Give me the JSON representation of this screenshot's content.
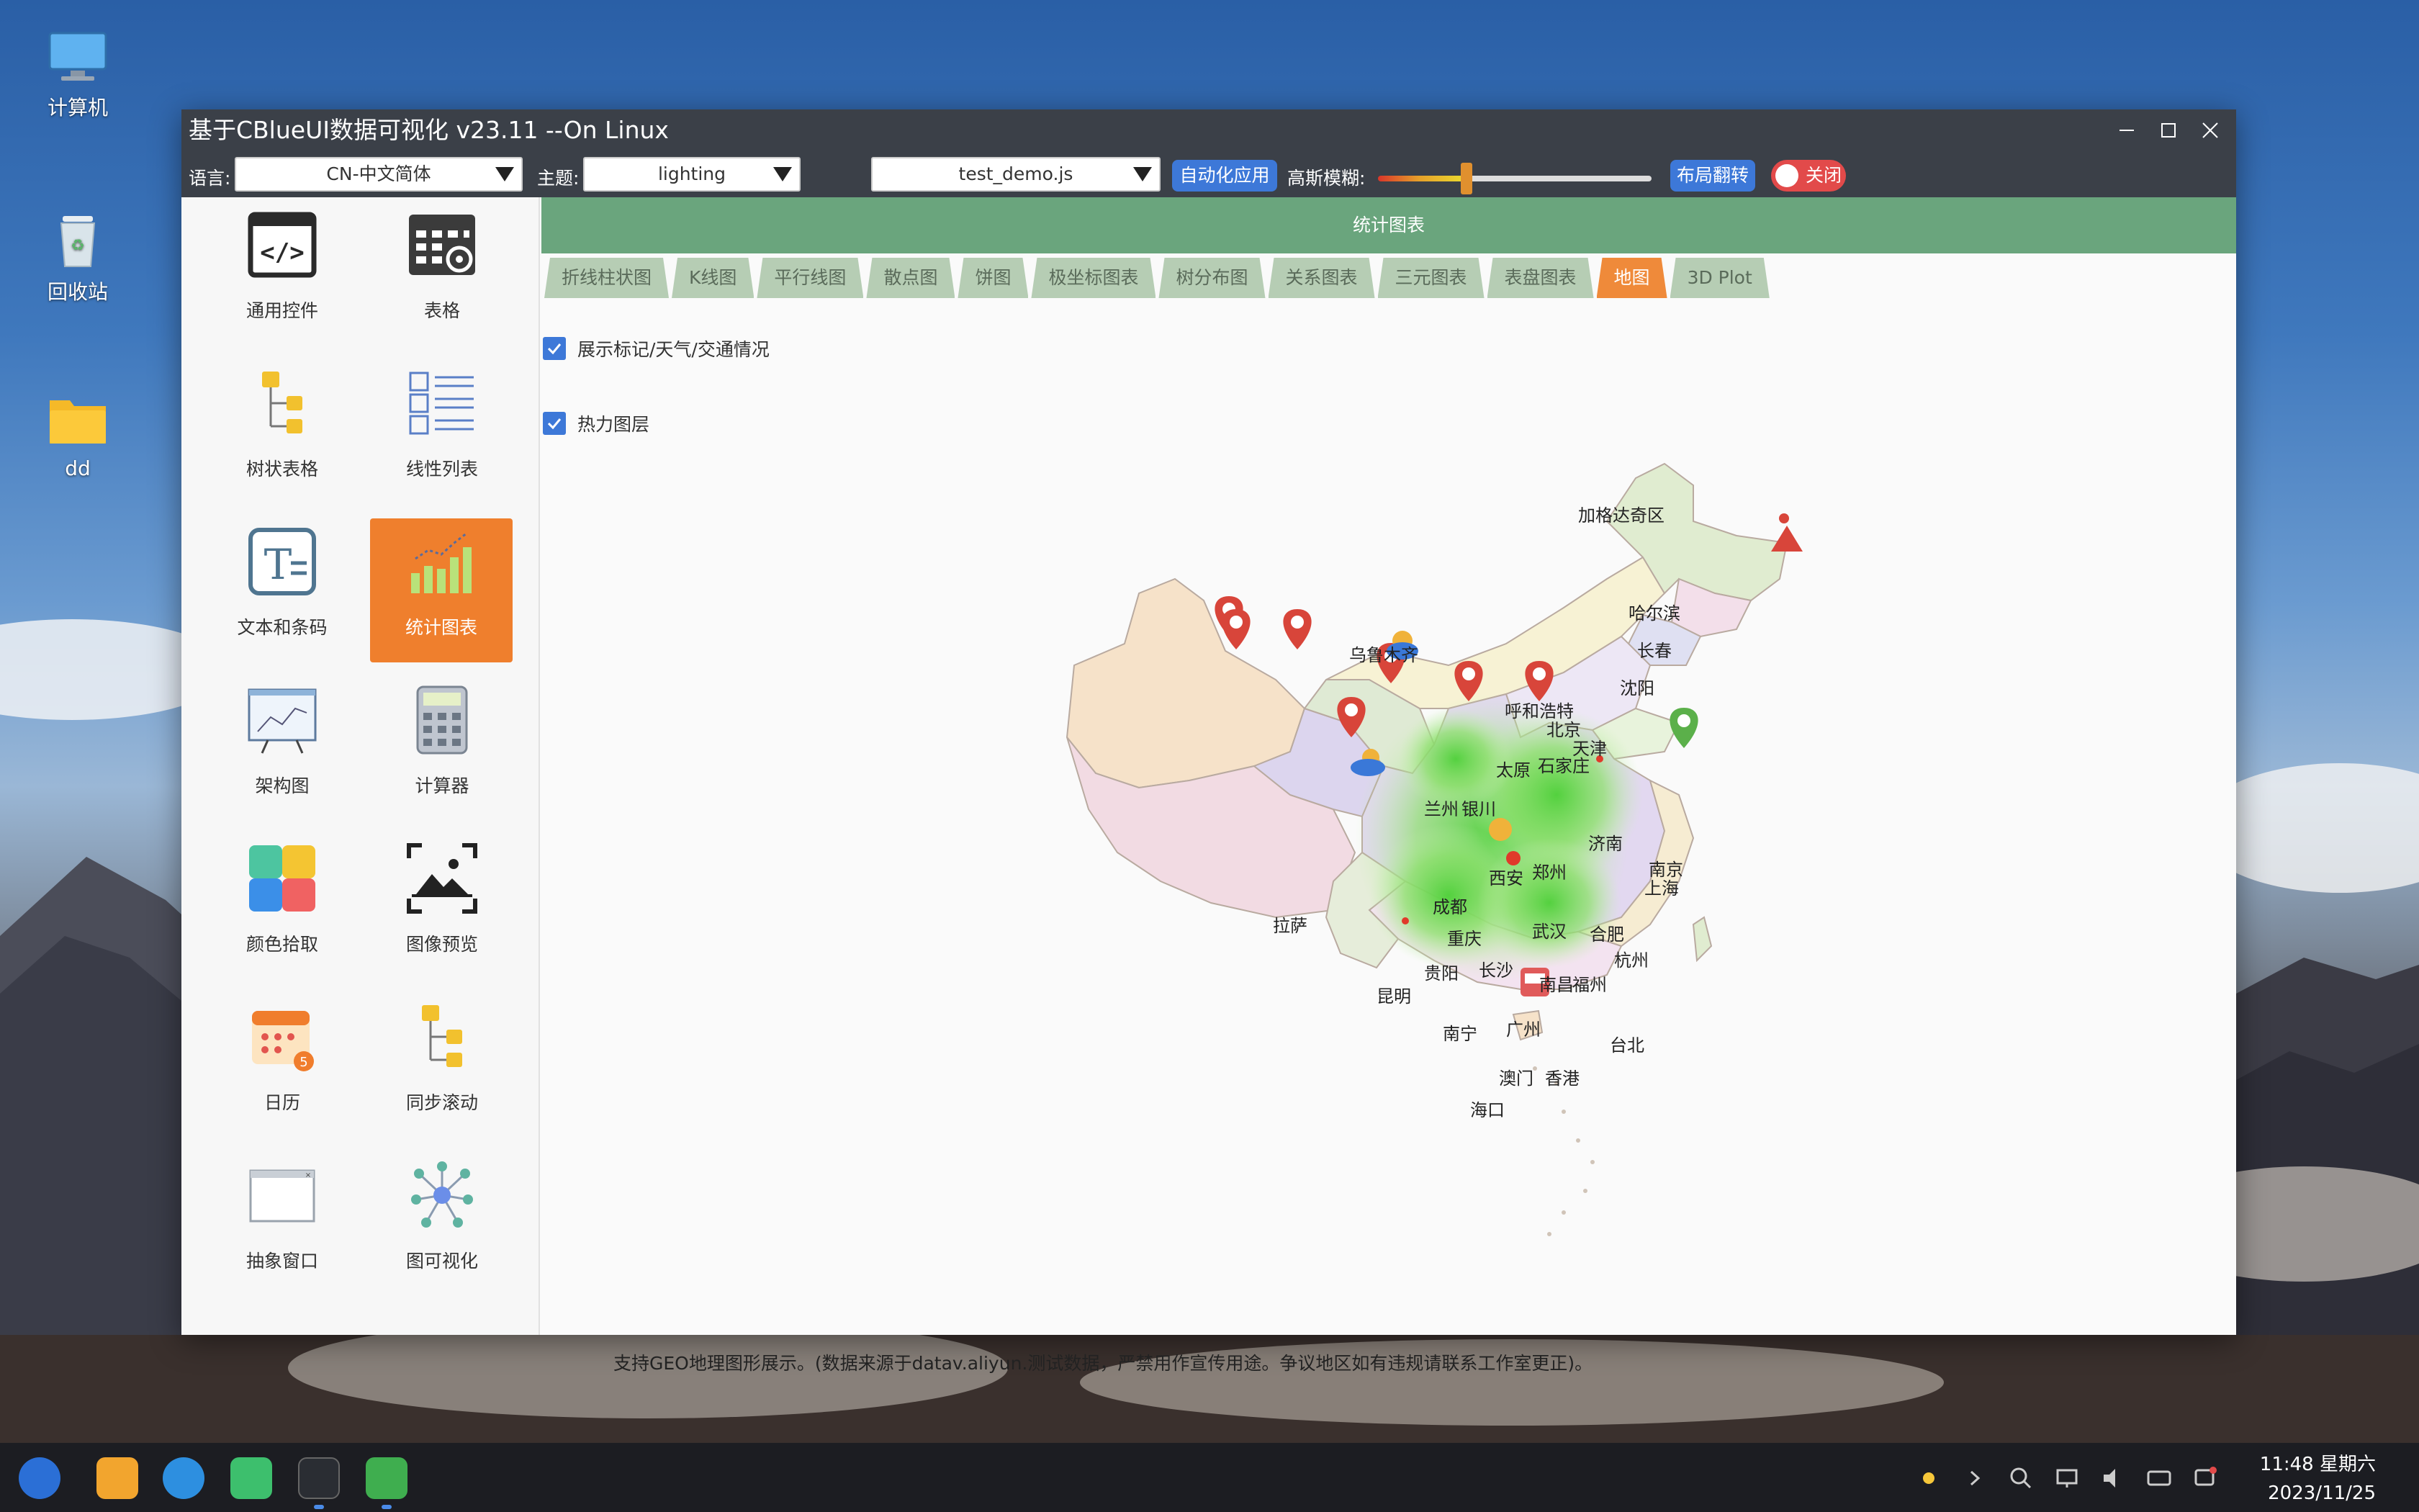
{
  "desktop": {
    "icons": [
      {
        "label": "计算机",
        "icon": "computer-icon"
      },
      {
        "label": "回收站",
        "icon": "trash-icon"
      },
      {
        "label": "dd",
        "icon": "folder-icon"
      }
    ]
  },
  "window": {
    "title": "基于CBlueUI数据可视化 v23.11 --On Linux",
    "toolbar": {
      "language_label": "语言:",
      "language_value": "CN-中文简体",
      "theme_label": "主题:",
      "theme_value": "lighting",
      "script_value": "test_demo.js",
      "auto_apply_label": "自动化应用",
      "blur_label": "高斯模糊:",
      "blur_level": 0.3,
      "flip_layout_label": "布局翻转",
      "toggle_label": "关闭"
    }
  },
  "sidebar": {
    "items": [
      {
        "label": "通用控件",
        "icon": "code-window-icon"
      },
      {
        "label": "表格",
        "icon": "table-settings-icon"
      },
      {
        "label": "树状表格",
        "icon": "tree-table-icon"
      },
      {
        "label": "线性列表",
        "icon": "linear-list-icon"
      },
      {
        "label": "文本和条码",
        "icon": "text-icon"
      },
      {
        "label": "统计图表",
        "icon": "bar-chart-icon",
        "active": true
      },
      {
        "label": "架构图",
        "icon": "architecture-icon"
      },
      {
        "label": "计算器",
        "icon": "calculator-icon"
      },
      {
        "label": "颜色拾取",
        "icon": "color-picker-icon"
      },
      {
        "label": "图像预览",
        "icon": "image-preview-icon"
      },
      {
        "label": "日历",
        "icon": "calendar-icon"
      },
      {
        "label": "同步滚动",
        "icon": "sync-scroll-icon"
      },
      {
        "label": "抽象窗口",
        "icon": "abstract-window-icon"
      },
      {
        "label": "图可视化",
        "icon": "graph-icon"
      }
    ]
  },
  "content": {
    "header": "统计图表",
    "tabs": [
      "折线柱状图",
      "K线图",
      "平行线图",
      "散点图",
      "饼图",
      "极坐标图表",
      "树分布图",
      "关系图表",
      "三元图表",
      "表盘图表",
      "地图",
      "3D Plot"
    ],
    "active_tab": "地图",
    "options": [
      {
        "label": "展示标记/天气/交通情况",
        "checked": true
      },
      {
        "label": "热力图层",
        "checked": true
      }
    ],
    "map_cities": [
      "加格达奇区",
      "哈尔滨",
      "长春",
      "沈阳",
      "乌鲁木齐",
      "呼和浩特",
      "北京",
      "天津",
      "石家庄",
      "太原",
      "兰州",
      "银川",
      "济南",
      "西安",
      "郑州",
      "南京",
      "上海",
      "成都",
      "拉萨",
      "重庆",
      "武汉",
      "合肥",
      "杭州",
      "贵阳",
      "长沙",
      "南昌",
      "福州",
      "昆明",
      "南宁",
      "广州",
      "台北",
      "澳门",
      "香港",
      "海口"
    ],
    "footer": "支持GEO地理图形展示。(数据来源于datav.aliyun.测试数据，严禁用作宣传用途。争议地区如有违规请联系工作室更正)。"
  },
  "taskbar": {
    "apps": [
      "launcher-icon",
      "files-icon",
      "browser-icon",
      "mail-icon",
      "terminal-icon",
      "app-a-icon"
    ],
    "tray": [
      "brightness-icon",
      "expand-arrow-icon",
      "search-icon",
      "network-icon",
      "volume-icon",
      "keyboard-icon",
      "notification-icon"
    ],
    "time": "11:48 星期六",
    "date": "2023/11/25"
  },
  "colors": {
    "titlebar": "#3b4048",
    "accent_orange": "#ef7f2d",
    "header_green": "#6aa57d",
    "button_blue": "#3d78d8",
    "marker_red": "#d8453a"
  }
}
